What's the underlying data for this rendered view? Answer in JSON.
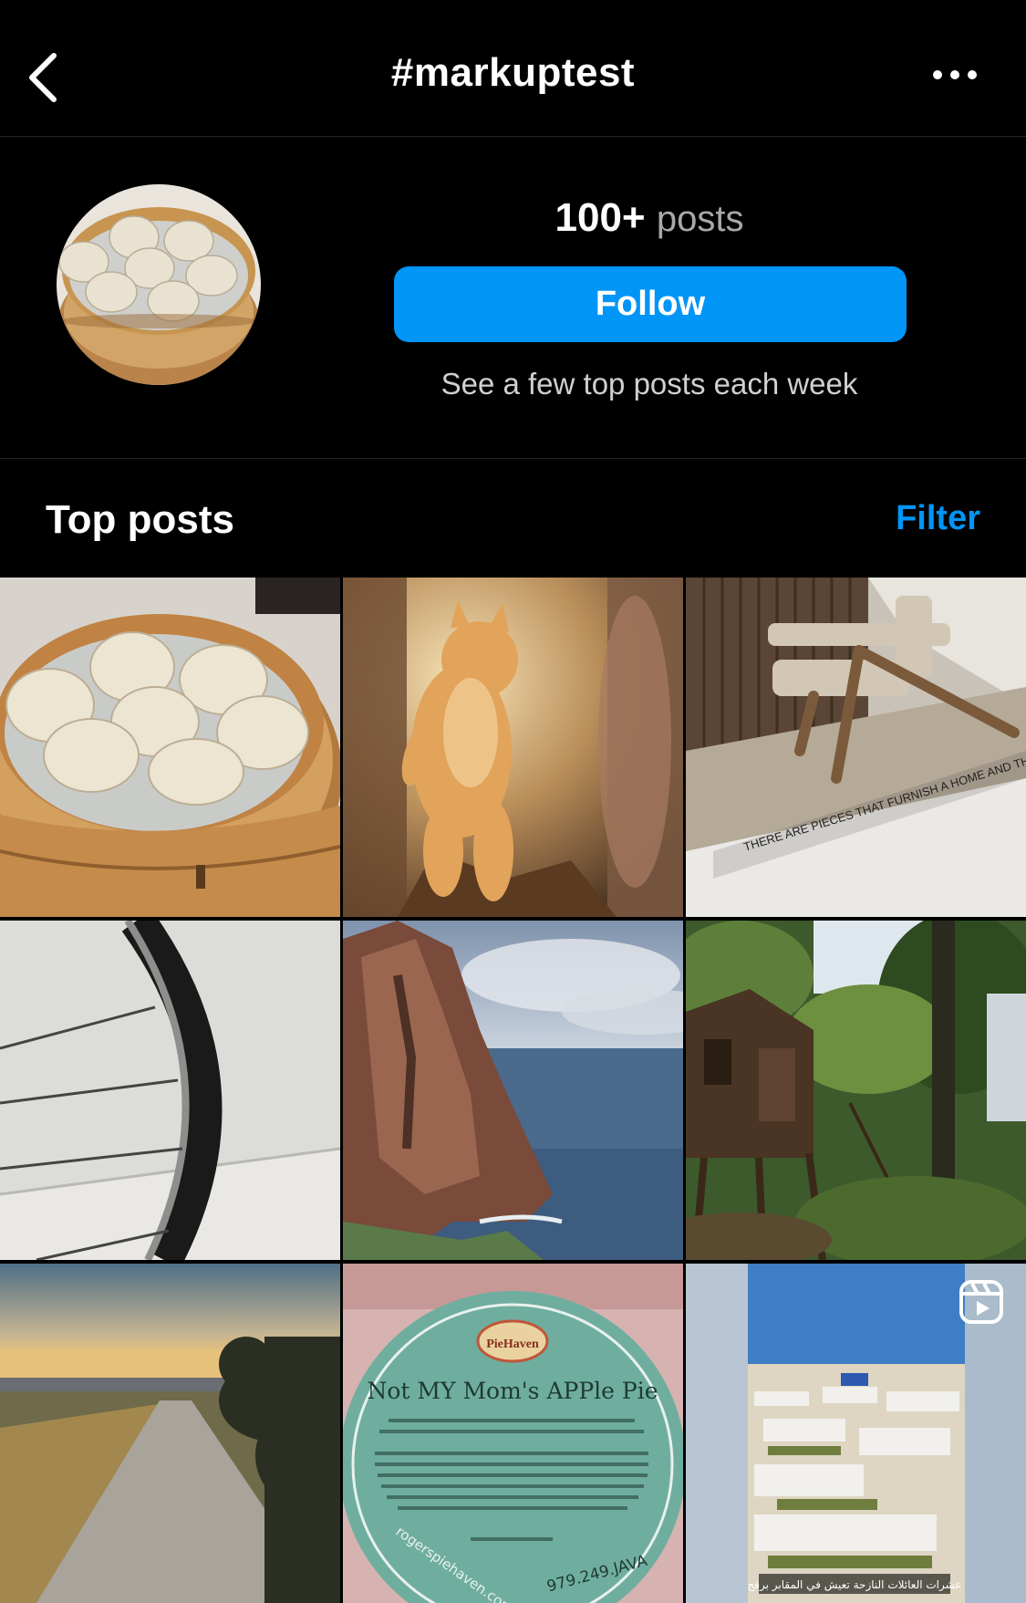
{
  "header": {
    "title": "#markuptest",
    "back_icon": "chevron-left-icon",
    "more_icon": "more-horizontal-icon"
  },
  "profile": {
    "posts_count": "100+",
    "posts_label": "posts",
    "follow_label": "Follow",
    "subtext": "See a few top posts each week"
  },
  "top_posts": {
    "title": "Top posts",
    "filter_label": "Filter"
  },
  "posts": [
    {
      "subject": "soup dumplings in bamboo steamer"
    },
    {
      "subject": "kitten standing in sunlight"
    },
    {
      "subject": "miniature chair display",
      "caption": "THERE ARE PIECES THAT FURNISH A HOME AND THOSE"
    },
    {
      "subject": "bicycle wheel close-up"
    },
    {
      "subject": "sea cliff by the ocean"
    },
    {
      "subject": "tree house in forest"
    },
    {
      "subject": "gravel path at sunset"
    },
    {
      "subject": "apple pie label",
      "label_title": "Not MY Mom's APPle Pie",
      "label_brand": "PieHaven",
      "label_phone": "979.249.JAVA",
      "label_web": "rogerspiehaven.com"
    },
    {
      "subject": "reel of cemetery scene",
      "caption": "عشرات العائلات النازحة تعيش في المقابر برفح",
      "badge_icon": "reels-icon"
    }
  ],
  "colors": {
    "accent": "#0095f6",
    "background": "#000000",
    "divider": "#262626"
  }
}
